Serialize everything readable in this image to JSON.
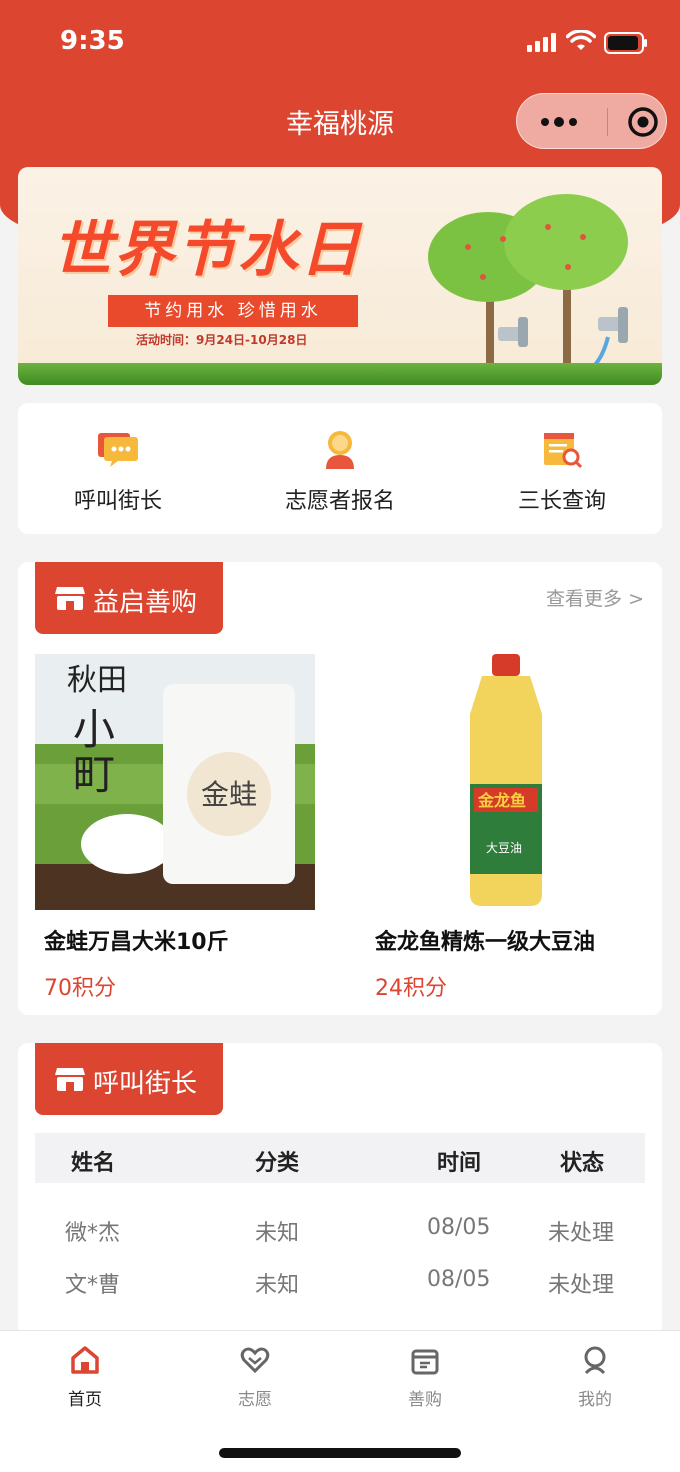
{
  "status": {
    "time": "9:35"
  },
  "app": {
    "title": "幸福桃源"
  },
  "banner": {
    "title": "世界节水日",
    "slogan": "节约用水 珍惜用水",
    "date": "活动时间：9月24日-10月28日"
  },
  "quick_links": [
    {
      "label": "呼叫街长",
      "icon": "chat-bubble-icon"
    },
    {
      "label": "志愿者报名",
      "icon": "volunteer-person-icon"
    },
    {
      "label": "三长查询",
      "icon": "document-search-icon"
    }
  ],
  "shop": {
    "title": "益启善购",
    "more": "查看更多 >",
    "products": [
      {
        "name": "金蛙万昌大米10斤",
        "price": "70积分"
      },
      {
        "name": "金龙鱼精炼一级大豆油",
        "price": "24积分"
      }
    ]
  },
  "call": {
    "title": "呼叫街长",
    "headers": [
      "姓名",
      "分类",
      "时间",
      "状态"
    ],
    "rows": [
      {
        "name": "微*杰",
        "category": "未知",
        "time": "08/05",
        "status": "未处理"
      },
      {
        "name": "文*曹",
        "category": "未知",
        "time": "08/05",
        "status": "未处理"
      }
    ]
  },
  "tabs": [
    {
      "label": "首页",
      "icon": "home-icon",
      "active": true
    },
    {
      "label": "志愿",
      "icon": "heart-hands-icon",
      "active": false
    },
    {
      "label": "善购",
      "icon": "shop-icon",
      "active": false
    },
    {
      "label": "我的",
      "icon": "user-icon",
      "active": false
    }
  ],
  "colors": {
    "brand": "#dc4631",
    "price": "#dc4631",
    "background": "#f3f3f3"
  }
}
